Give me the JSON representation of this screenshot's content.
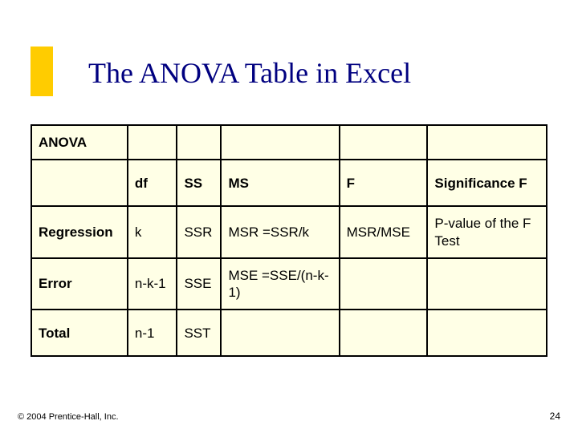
{
  "title": "The ANOVA Table in Excel",
  "table": {
    "r0": {
      "c0": "ANOVA",
      "c1": "",
      "c2": "",
      "c3": "",
      "c4": "",
      "c5": ""
    },
    "r1": {
      "c0": "",
      "c1": "df",
      "c2": "SS",
      "c3": "MS",
      "c4": "F",
      "c5": "Significance F"
    },
    "r2": {
      "c0": "Regression",
      "c1": "k",
      "c2": "SSR",
      "c3": "MSR =SSR/k",
      "c4": "MSR/MSE",
      "c5": "P-value of the F Test"
    },
    "r3": {
      "c0": "Error",
      "c1": "n-k-1",
      "c2": "SSE",
      "c3": "MSE =SSE/(n-k-1)",
      "c4": "",
      "c5": ""
    },
    "r4": {
      "c0": "Total",
      "c1": "n-1",
      "c2": "SST",
      "c3": "",
      "c4": "",
      "c5": ""
    }
  },
  "footer": {
    "copyright": "© 2004 Prentice-Hall, Inc.",
    "page": "24"
  },
  "chart_data": {
    "type": "table",
    "title": "The ANOVA Table in Excel",
    "columns": [
      "",
      "df",
      "SS",
      "MS",
      "F",
      "Significance F"
    ],
    "rows": [
      [
        "Regression",
        "k",
        "SSR",
        "MSR =SSR/k",
        "MSR/MSE",
        "P-value of the F Test"
      ],
      [
        "Error",
        "n-k-1",
        "SSE",
        "MSE =SSE/(n-k-1)",
        "",
        ""
      ],
      [
        "Total",
        "n-1",
        "SST",
        "",
        "",
        ""
      ]
    ]
  }
}
